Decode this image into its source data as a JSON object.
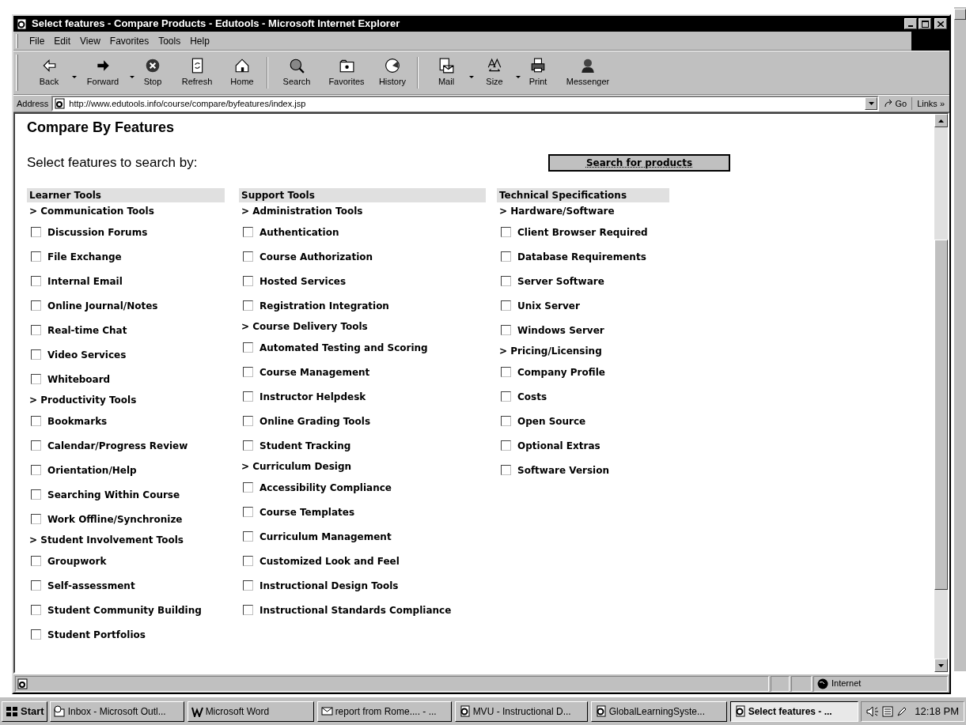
{
  "window": {
    "title": "Select features - Compare Products - Edutools - Microsoft Internet Explorer"
  },
  "menu": [
    "File",
    "Edit",
    "View",
    "Favorites",
    "Tools",
    "Help"
  ],
  "toolbar": [
    {
      "label": "Back",
      "kind": "back",
      "dropdown": true
    },
    {
      "label": "Forward",
      "kind": "forward",
      "dropdown": true
    },
    {
      "label": "Stop",
      "kind": "stop",
      "dropdown": false
    },
    {
      "label": "Refresh",
      "kind": "refresh",
      "dropdown": false
    },
    {
      "label": "Home",
      "kind": "home",
      "dropdown": false
    },
    {
      "label": "Search",
      "kind": "search",
      "dropdown": false
    },
    {
      "label": "Favorites",
      "kind": "favorites",
      "dropdown": false
    },
    {
      "label": "History",
      "kind": "history",
      "dropdown": false
    },
    {
      "label": "Mail",
      "kind": "mail",
      "dropdown": true
    },
    {
      "label": "Size",
      "kind": "size",
      "dropdown": true
    },
    {
      "label": "Print",
      "kind": "print",
      "dropdown": false
    },
    {
      "label": "Messenger",
      "kind": "messenger",
      "dropdown": false
    }
  ],
  "address": {
    "label": "Address",
    "url": "http://www.edutools.info/course/compare/byfeatures/index.jsp",
    "go": "Go",
    "links": "Links »"
  },
  "page": {
    "heading": "Compare By Features",
    "subheading": "Select features to search by:",
    "search_button": "Search for products",
    "columns": [
      {
        "title": "Learner Tools",
        "groups": [
          {
            "title": "> Communication Tools",
            "items": [
              {
                "label": "Discussion Forums",
                "checked": false
              },
              {
                "label": "File Exchange",
                "checked": false
              },
              {
                "label": "Internal Email",
                "checked": false
              },
              {
                "label": "Online Journal/Notes",
                "checked": false
              },
              {
                "label": "Real-time Chat",
                "checked": false
              },
              {
                "label": "Video Services",
                "checked": false
              },
              {
                "label": "Whiteboard",
                "checked": false
              }
            ]
          },
          {
            "title": "> Productivity Tools",
            "items": [
              {
                "label": "Bookmarks",
                "checked": false
              },
              {
                "label": "Calendar/Progress Review",
                "checked": false
              },
              {
                "label": "Orientation/Help",
                "checked": false
              },
              {
                "label": "Searching Within Course",
                "checked": false
              },
              {
                "label": "Work Offline/Synchronize",
                "checked": false
              }
            ]
          },
          {
            "title": "> Student Involvement Tools",
            "items": [
              {
                "label": "Groupwork",
                "checked": false
              },
              {
                "label": "Self-assessment",
                "checked": false
              },
              {
                "label": "Student Community Building",
                "checked": false
              },
              {
                "label": "Student Portfolios",
                "checked": false
              }
            ]
          }
        ]
      },
      {
        "title": "Support Tools",
        "groups": [
          {
            "title": "> Administration Tools",
            "items": [
              {
                "label": "Authentication",
                "checked": false
              },
              {
                "label": "Course Authorization",
                "checked": false
              },
              {
                "label": "Hosted Services",
                "checked": false
              },
              {
                "label": "Registration Integration",
                "checked": false
              }
            ]
          },
          {
            "title": "> Course Delivery Tools",
            "items": [
              {
                "label": "Automated Testing and Scoring",
                "checked": false
              },
              {
                "label": "Course Management",
                "checked": false
              },
              {
                "label": "Instructor Helpdesk",
                "checked": false
              },
              {
                "label": "Online Grading Tools",
                "checked": false
              },
              {
                "label": "Student Tracking",
                "checked": false
              }
            ]
          },
          {
            "title": "> Curriculum Design",
            "items": [
              {
                "label": "Accessibility Compliance",
                "checked": false
              },
              {
                "label": "Course Templates",
                "checked": false
              },
              {
                "label": "Curriculum Management",
                "checked": false
              },
              {
                "label": "Customized Look and Feel",
                "checked": false
              },
              {
                "label": "Instructional Design Tools",
                "checked": false
              },
              {
                "label": "Instructional Standards Compliance",
                "checked": false
              }
            ]
          }
        ]
      },
      {
        "title": "Technical Specifications",
        "groups": [
          {
            "title": "> Hardware/Software",
            "items": [
              {
                "label": "Client Browser Required",
                "checked": false
              },
              {
                "label": "Database Requirements",
                "checked": false
              },
              {
                "label": "Server Software",
                "checked": false
              },
              {
                "label": "Unix Server",
                "checked": false
              },
              {
                "label": "Windows Server",
                "checked": false
              }
            ]
          },
          {
            "title": "> Pricing/Licensing",
            "items": [
              {
                "label": "Company Profile",
                "checked": false
              },
              {
                "label": "Costs",
                "checked": false
              },
              {
                "label": "Open Source",
                "checked": false
              },
              {
                "label": "Optional Extras",
                "checked": false
              },
              {
                "label": "Software Version",
                "checked": false
              }
            ]
          }
        ]
      }
    ]
  },
  "status_bar": {
    "zone": "Internet"
  },
  "taskbar": {
    "start": "Start",
    "tasks": [
      {
        "label": "Inbox - Microsoft Outl...",
        "kind": "outlook",
        "selected": false
      },
      {
        "label": "Microsoft Word",
        "kind": "word",
        "selected": false
      },
      {
        "label": "report from Rome.... - ...",
        "kind": "mail",
        "selected": false
      },
      {
        "label": "MVU - Instructional D...",
        "kind": "ie",
        "selected": false
      },
      {
        "label": "GlobalLearningSyste...",
        "kind": "ie",
        "selected": false
      },
      {
        "label": "Select features - ...",
        "kind": "ie",
        "selected": true
      }
    ],
    "clock": "12:18 PM"
  }
}
